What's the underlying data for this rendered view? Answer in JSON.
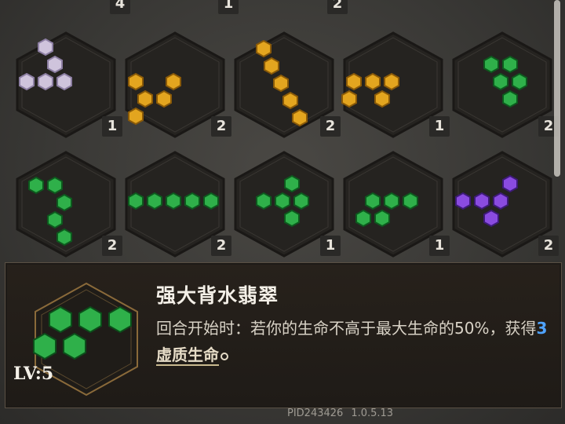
{
  "grid": {
    "top_row_counts": [
      "4",
      "1",
      "2"
    ],
    "rows": [
      [
        {
          "gem": "silver",
          "count": "1"
        },
        {
          "gem": "gold",
          "count": "2"
        },
        {
          "gem": "gold",
          "count": "2"
        },
        {
          "gem": "gold",
          "count": "1"
        },
        {
          "gem": "green",
          "count": "2"
        }
      ],
      [
        {
          "gem": "green",
          "count": "2"
        },
        {
          "gem": "green",
          "count": "2"
        },
        {
          "gem": "green",
          "count": "1"
        },
        {
          "gem": "green",
          "count": "1"
        },
        {
          "gem": "purple",
          "count": "2"
        }
      ]
    ]
  },
  "tooltip": {
    "title": "强大背水翡翠",
    "desc_prefix": "回合开始时：若你的生命不高于最大生命的50%，获得",
    "desc_number": "3",
    "desc_keyword": "虚质生命",
    "level": "LV:5",
    "gem": "green"
  },
  "footer": {
    "pid": "PID243426",
    "version": "1.0.5.13"
  },
  "colors": {
    "gold": "#e0a020",
    "green": "#2fb04a",
    "silver": "#c8bcd8",
    "purple": "#8a4be0"
  }
}
